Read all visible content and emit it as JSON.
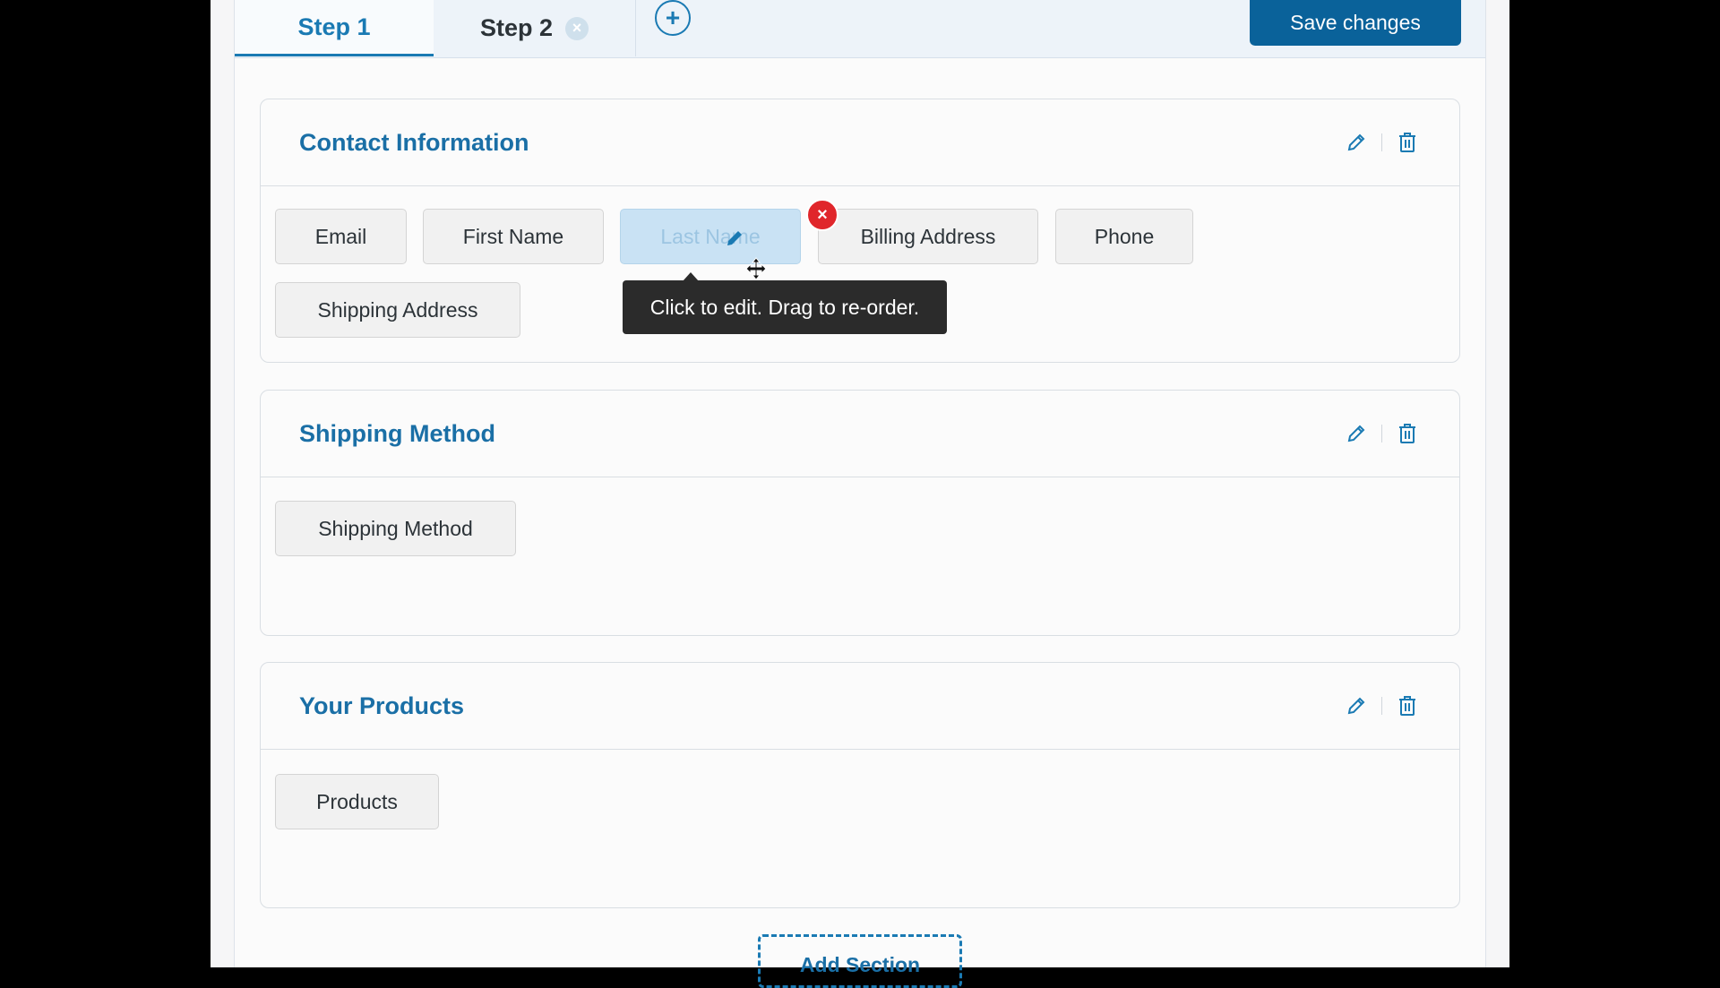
{
  "tabs": [
    {
      "label": "Step 1",
      "active": true
    },
    {
      "label": "Step 2",
      "active": false,
      "close_icon": "close-circle-icon"
    }
  ],
  "add_step_icon": "plus-circle-icon",
  "save_button": "Save changes",
  "sections": [
    {
      "title": "Contact Information",
      "fields": [
        "Email",
        "First Name",
        "Last Name",
        "Billing Address",
        "Phone",
        "Shipping Address"
      ],
      "actions": [
        "pencil-icon",
        "trash-icon"
      ]
    },
    {
      "title": "Shipping Method",
      "fields": [
        "Shipping Method"
      ],
      "actions": [
        "pencil-icon",
        "trash-icon"
      ]
    },
    {
      "title": "Your Products",
      "fields": [
        "Products"
      ],
      "actions": [
        "pencil-icon",
        "trash-icon"
      ]
    }
  ],
  "active_field": "Last Name",
  "tooltip": "Click to edit. Drag to re-order.",
  "add_section": "Add Section",
  "colors": {
    "accent": "#1a7ab3",
    "save_bg": "#0a629a",
    "remove_badge": "#e0262b",
    "active_field_bg": "#c9e2f4"
  }
}
